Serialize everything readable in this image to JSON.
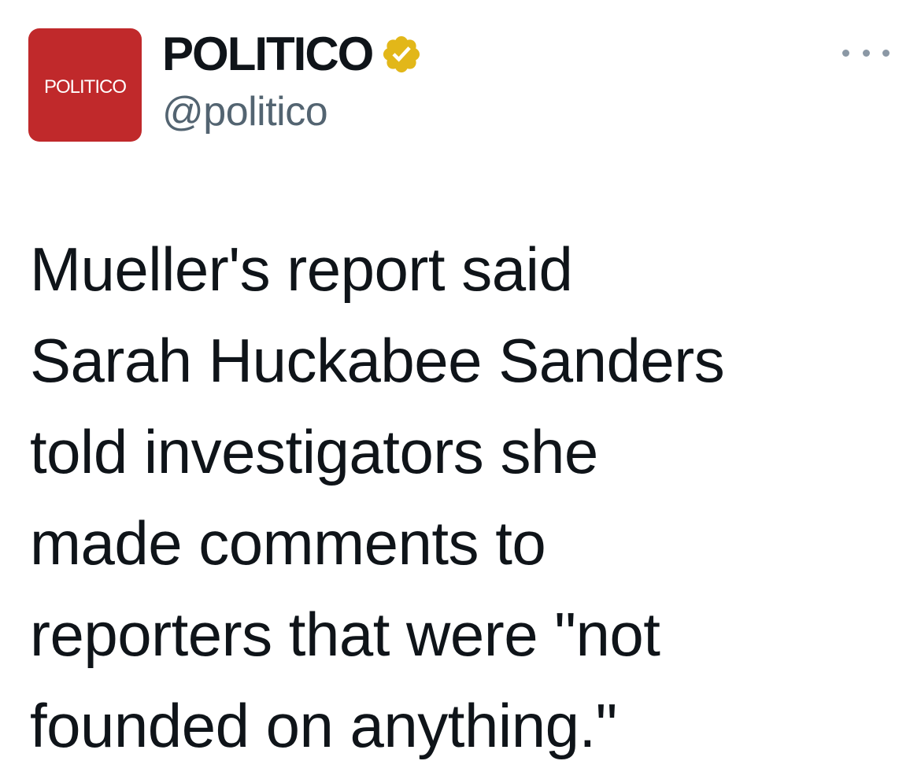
{
  "author": {
    "avatar_text": "POLITICO",
    "avatar_color": "#c0292b",
    "display_name": "POLITICO",
    "handle": "@politico",
    "verified_badge_color": "#e2b719",
    "verified_icon": "verified-badge-icon"
  },
  "actions": {
    "more_icon": "more-horizontal-icon"
  },
  "tweet": {
    "text": "Mueller's report said\nSarah Huckabee Sanders\ntold investigators she\nmade comments to\nreporters that were \"not\nfounded on anything.\""
  }
}
